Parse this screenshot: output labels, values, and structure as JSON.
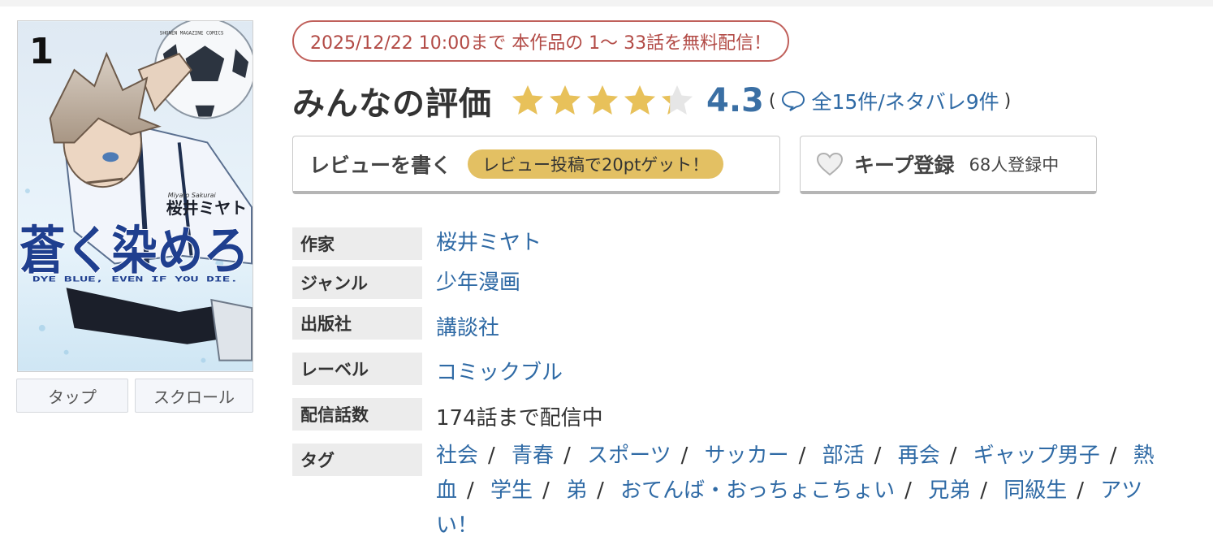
{
  "campaign_text": "2025/12/22 10:00まで 本作品の 1〜 33話を無料配信！",
  "cover": {
    "volume_number": "1",
    "magazine_line": "SHONEN MAGAZINE COMICS",
    "author_romaji": "Miyato Sakurai",
    "author_kana": "桜井ミヤト",
    "title_art": "蒼く染めろ",
    "subtitle_en": "DYE BLUE, EVEN IF YOU DIE.",
    "tap_label": "タップ",
    "scroll_label": "スクロール"
  },
  "rating": {
    "title": "みんなの評価",
    "score": "4.3",
    "star_value": 4.3,
    "star_max": 5,
    "paren_open": "(",
    "paren_close": ")",
    "reviews_text": "全15件/ネタバレ9件",
    "star_color": "#e8c15a",
    "score_color": "#3a6fa4"
  },
  "actions": {
    "write_review_label": "レビューを書く",
    "reward_badge": "レビュー投稿で20ptゲット！",
    "keep_label": "キープ登録",
    "keep_count": "68人登録中"
  },
  "info": {
    "author_label": "作家",
    "author_value": "桜井ミヤト",
    "genre_label": "ジャンル",
    "genre_value": "少年漫画",
    "publisher_label": "出版社",
    "publisher_value": "講談社",
    "label_label": "レーベル",
    "label_value": "コミックブル",
    "episodes_label": "配信話数",
    "episodes_value": "174話まで配信中",
    "tags_label": "タグ",
    "tags": [
      "社会",
      "青春",
      "スポーツ",
      "サッカー",
      "部活",
      "再会",
      "ギャップ男子",
      "熱血",
      "学生",
      "弟",
      "おてんば・おっちょこちょい",
      "兄弟",
      "同級生",
      "アツい！"
    ],
    "tag_separator": "/"
  }
}
